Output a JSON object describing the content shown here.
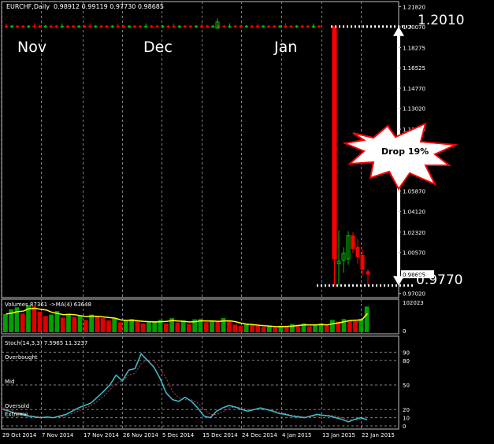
{
  "window": {
    "symbol_title": "EURCHF,Daily",
    "ohlc_readout": "0.98912 0.99119 0.97730 0.98685"
  },
  "colors": {
    "background": "#000000",
    "frame": "#c0c0c0",
    "grid": "#7f7f7f",
    "bull_candle": "#00c000",
    "bear_candle": "#ff0000",
    "volume_up": "#00a000",
    "volume_down": "#e00000",
    "ma_line": "#ffff00",
    "stoch_main": "#40c0d0",
    "stoch_signal": "#c04040",
    "annotation": "#ffffff",
    "price_marker_bg": "#ffffff"
  },
  "annotations": {
    "month_nov": "Nov",
    "month_dec": "Dec",
    "month_jan": "Jan",
    "level_high": "1.2010",
    "level_low": "0.9770",
    "callout": "Drop 19%"
  },
  "chart_data": [
    {
      "type": "candlestick",
      "title": "EURCHF,Daily",
      "price_axis_ticks": [
        "1.21820",
        "1.20070",
        "1.18275",
        "1.16525",
        "1.14770",
        "1.13020",
        "1.11220",
        "1.09420",
        "1.07670",
        "1.05870",
        "1.04120",
        "1.02320",
        "1.00570",
        "0.98685",
        "0.97020"
      ],
      "current_price": "0.98685",
      "ylim": [
        0.97,
        1.2185
      ],
      "x_ticks": [
        "29 Oct 2014",
        "7 Nov 2014",
        "17 Nov 2014",
        "26 Nov 2014",
        "5 Dec 2014",
        "15 Dec 2014",
        "24 Dec 2014",
        "4 Jan 2015",
        "13 Jan 2015",
        "22 Jan 2015"
      ],
      "candles_flat_period": {
        "from": "29 Oct 2014",
        "to": "14 Jan 2015",
        "level": 1.201,
        "count": 57
      },
      "candles_after_drop": [
        {
          "open": 1.201,
          "high": 1.201,
          "low": 0.977,
          "close": 1.0
        },
        {
          "open": 0.996,
          "high": 1.025,
          "low": 0.977,
          "close": 0.998
        },
        {
          "open": 0.999,
          "high": 1.01,
          "low": 0.988,
          "close": 1.005
        },
        {
          "open": 1.0,
          "high": 1.024,
          "low": 0.995,
          "close": 1.02
        },
        {
          "open": 1.02,
          "high": 1.023,
          "low": 1.005,
          "close": 1.009
        },
        {
          "open": 1.01,
          "high": 1.017,
          "low": 0.996,
          "close": 1.002
        },
        {
          "open": 1.003,
          "high": 1.008,
          "low": 0.986,
          "close": 0.991
        },
        {
          "open": 0.9891,
          "high": 0.9912,
          "low": 0.9773,
          "close": 0.9869
        }
      ]
    },
    {
      "type": "bar",
      "title": "Volumes 87361 ->MA(4) 63648",
      "axis_ticks": [
        "102023",
        "0"
      ],
      "ylim": [
        0,
        102023
      ],
      "values": [
        62000,
        78000,
        85000,
        64000,
        92000,
        88000,
        70000,
        55000,
        60000,
        72000,
        50000,
        62000,
        52000,
        58000,
        42000,
        60000,
        55000,
        48000,
        40000,
        46000,
        34000,
        40000,
        45000,
        38000,
        30000,
        35000,
        38000,
        42000,
        30000,
        48000,
        33000,
        40000,
        28000,
        44000,
        45000,
        34000,
        38000,
        35000,
        48000,
        38000,
        26000,
        22000,
        30000,
        25000,
        22000,
        18000,
        20000,
        16000,
        22000,
        20000,
        28000,
        25000,
        30000,
        20000,
        24000,
        30000,
        22000,
        42000,
        36000,
        45000,
        40000,
        38000,
        46000,
        87361
      ],
      "ma_values": [
        62000,
        65000,
        70000,
        72000,
        80000,
        82000,
        78000,
        76000,
        68000,
        64000,
        60000,
        61000,
        60000,
        56000,
        53000,
        55000,
        54000,
        52000,
        50000,
        48000,
        42000,
        40000,
        41000,
        39000,
        37000,
        36000,
        35000,
        36000,
        37000,
        40000,
        38000,
        37000,
        35000,
        36000,
        39000,
        38000,
        38000,
        37000,
        38000,
        39000,
        36000,
        31000,
        27000,
        26000,
        24000,
        22000,
        21000,
        19000,
        19000,
        20000,
        21000,
        23000,
        25000,
        25000,
        25000,
        26000,
        25000,
        29000,
        32000,
        36000,
        40000,
        41000,
        42000,
        63648
      ]
    },
    {
      "type": "line",
      "title": "Stoch(14,3,3) 7.5965 11.3237",
      "level_labels": [
        "Overbought",
        "Mid",
        "Oversold",
        "Extreme"
      ],
      "axis_ticks": [
        "90",
        "80",
        "50",
        "20",
        "10",
        "0"
      ],
      "ylim": [
        0,
        100
      ],
      "main_values": [
        20,
        18,
        15,
        14,
        12,
        11,
        10,
        11,
        10,
        12,
        14,
        18,
        22,
        25,
        28,
        35,
        42,
        50,
        62,
        55,
        68,
        70,
        88,
        80,
        72,
        58,
        40,
        32,
        30,
        35,
        30,
        22,
        12,
        10,
        18,
        22,
        25,
        23,
        20,
        18,
        20,
        22,
        20,
        18,
        15,
        14,
        12,
        11,
        10,
        12,
        14,
        13,
        12,
        10,
        8,
        5,
        8,
        10,
        7.6
      ],
      "signal_values": [
        22,
        20,
        17,
        15,
        13,
        12,
        11,
        10,
        10,
        11,
        12,
        15,
        18,
        22,
        25,
        30,
        36,
        44,
        52,
        55,
        62,
        64,
        76,
        80,
        80,
        70,
        58,
        42,
        34,
        32,
        32,
        28,
        20,
        14,
        14,
        17,
        22,
        23,
        22,
        20,
        20,
        20,
        20,
        19,
        17,
        15,
        13,
        12,
        11,
        11,
        12,
        13,
        13,
        12,
        10,
        8,
        7,
        8,
        11.3
      ]
    }
  ]
}
